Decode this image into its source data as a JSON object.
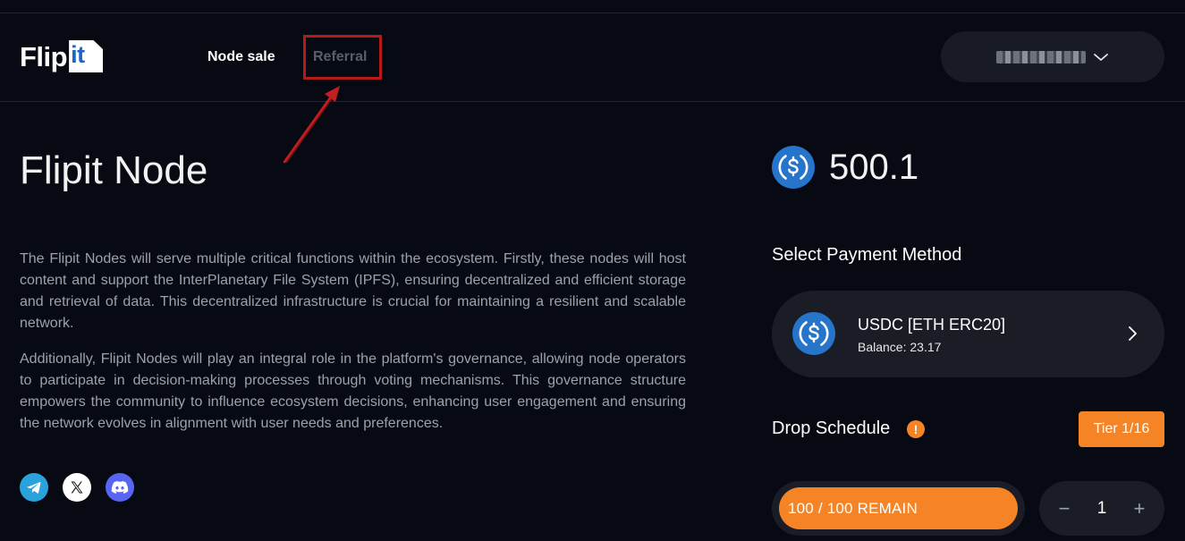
{
  "header": {
    "logo": {
      "part1": "Flip",
      "part2": "it"
    },
    "nav": [
      {
        "label": "Node sale",
        "active": true
      },
      {
        "label": "Referral",
        "active": false
      }
    ],
    "wallet": {
      "address": "blurred",
      "chevron": "chevron-down-icon"
    }
  },
  "annotation": {
    "highlight_color": "#b31b1b",
    "target": "Referral"
  },
  "main": {
    "title": "Flipit Node",
    "paragraphs": [
      "The Flipit Nodes will serve multiple critical functions within the ecosystem. Firstly, these nodes will host content and support the InterPlanetary File System (IPFS), ensuring decentralized and efficient storage and retrieval of data. This decentralized infrastructure is crucial for maintaining a resilient and scalable network.",
      "Additionally, Flipit Nodes will play an integral role in the platform's governance, allowing node operators to participate in decision-making processes through voting mechanisms. This governance structure empowers the community to influence ecosystem decisions, enhancing user engagement and ensuring the network evolves in alignment with user needs and preferences."
    ],
    "social": [
      "telegram-icon",
      "x-icon",
      "discord-icon"
    ]
  },
  "sidebar": {
    "price": "500.1",
    "price_icon": "usdc-icon",
    "payment_section_label": "Select Payment Method",
    "payment": {
      "name": "USDC [ETH ERC20]",
      "balance": "Balance: 23.17",
      "icon": "usdc-icon"
    },
    "drop_schedule_label": "Drop Schedule",
    "tier": "Tier 1/16",
    "remain": "100 / 100 REMAIN",
    "remain_fraction": 1.0,
    "quantity": "1",
    "minus": "−",
    "plus": "+"
  },
  "colors": {
    "background": "#070a13",
    "accent": "#f58426",
    "card": "#1a1d26",
    "usdc": "#2775ca"
  }
}
